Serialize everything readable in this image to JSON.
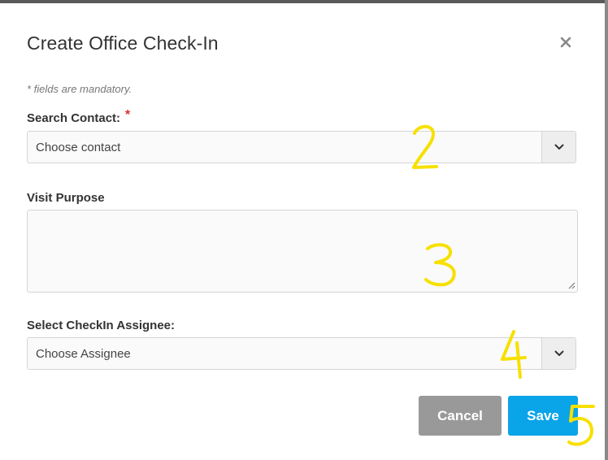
{
  "dialog": {
    "title": "Create Office Check-In",
    "mandatory_note": "* fields are mandatory."
  },
  "form": {
    "contact": {
      "label": "Search Contact:",
      "required_mark": "*",
      "placeholder": "Choose contact"
    },
    "visit_purpose": {
      "label": "Visit Purpose",
      "value": ""
    },
    "assignee": {
      "label": "Select CheckIn Assignee:",
      "placeholder": "Choose Assignee"
    }
  },
  "actions": {
    "cancel_label": "Cancel",
    "save_label": "Save"
  },
  "icons": {
    "close": "close-icon",
    "dropdown": "chevron-down-icon"
  },
  "colors": {
    "save": "#0aa4e8",
    "cancel": "#999999",
    "required": "#d9312a",
    "annotation": "#f7e000"
  }
}
